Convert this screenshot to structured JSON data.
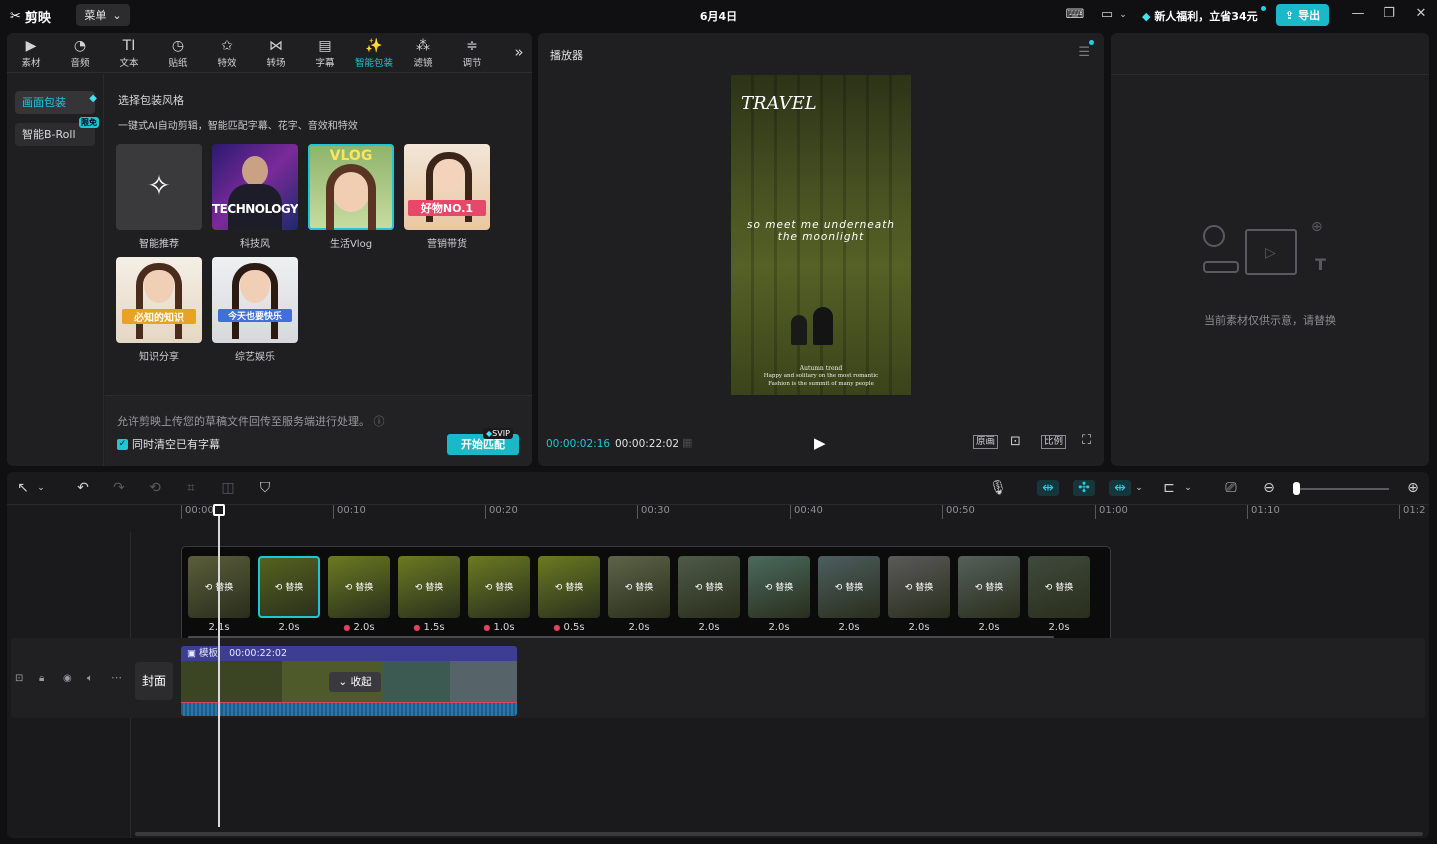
{
  "app": {
    "name": "剪映",
    "menu": "菜单",
    "date": "6月4日",
    "promo": "新人福利，立省34元",
    "export": "导出"
  },
  "toolbar_tabs": [
    {
      "label": "素材",
      "icon": "media-icon"
    },
    {
      "label": "音频",
      "icon": "audio-icon"
    },
    {
      "label": "文本",
      "icon": "text-icon"
    },
    {
      "label": "贴纸",
      "icon": "sticker-icon"
    },
    {
      "label": "特效",
      "icon": "effect-icon"
    },
    {
      "label": "转场",
      "icon": "transition-icon"
    },
    {
      "label": "字幕",
      "icon": "caption-icon"
    },
    {
      "label": "智能包装",
      "icon": "smart-pack-icon"
    },
    {
      "label": "滤镜",
      "icon": "filter-icon"
    },
    {
      "label": "调节",
      "icon": "adjust-icon"
    }
  ],
  "sidebar": {
    "item1": "画面包装",
    "item2": "智能B-Roll",
    "free_badge": "限免"
  },
  "panel": {
    "title": "选择包装风格",
    "subtitle": "一键式AI自动剪辑，智能匹配字幕、花字、音效和特效",
    "styles": [
      {
        "label": "智能推荐"
      },
      {
        "label": "科技风",
        "overlay": "TECHNOLOGY"
      },
      {
        "label": "生活Vlog",
        "overlay": "VLOG"
      },
      {
        "label": "营销带货",
        "overlay": "好物NO.1"
      },
      {
        "label": "知识分享",
        "overlay": "必知的知识"
      },
      {
        "label": "综艺娱乐",
        "overlay": "今天也要快乐"
      }
    ],
    "footer_note": "允许剪映上传您的草稿文件回传至服务端进行处理。",
    "checkbox_label": "同时清空已有字幕",
    "start_button": "开始匹配",
    "svip": "SVIP"
  },
  "player": {
    "title": "播放器",
    "video_title": "TRAVEL",
    "video_line1": "so meet me underneath",
    "video_line2": "the moonlight",
    "video_caption1": "Autumn trend",
    "video_caption2": "Happy and solitary on the most romantic",
    "video_caption3": "Fashion is the summit of many people",
    "current_time": "00:00:02:16",
    "total_time": "00:00:22:02",
    "btn_original": "原画",
    "btn_ratio": "比例"
  },
  "right_panel": {
    "note": "当前素材仅供示意，请替换"
  },
  "timeline": {
    "ruler": [
      "00:00",
      "00:10",
      "00:20",
      "00:30",
      "00:40",
      "00:50",
      "01:00",
      "01:10",
      "01:2"
    ],
    "replace": "替换",
    "clips": [
      {
        "duration": "2.1s",
        "dot": false,
        "selected": false,
        "color": "#5a5e3a"
      },
      {
        "duration": "2.0s",
        "dot": false,
        "selected": true,
        "color": "#56641f"
      },
      {
        "duration": "2.0s",
        "dot": true,
        "selected": false,
        "color": "#6b7a22"
      },
      {
        "duration": "1.5s",
        "dot": true,
        "selected": false,
        "color": "#6b7a22"
      },
      {
        "duration": "1.0s",
        "dot": true,
        "selected": false,
        "color": "#6b7a22"
      },
      {
        "duration": "0.5s",
        "dot": true,
        "selected": false,
        "color": "#6b7a22"
      },
      {
        "duration": "2.0s",
        "dot": false,
        "selected": false,
        "color": "#5e6448"
      },
      {
        "duration": "2.0s",
        "dot": false,
        "selected": false,
        "color": "#4e5a48"
      },
      {
        "duration": "2.0s",
        "dot": false,
        "selected": false,
        "color": "#4a6a5e"
      },
      {
        "duration": "2.0s",
        "dot": false,
        "selected": false,
        "color": "#4c5e60"
      },
      {
        "duration": "2.0s",
        "dot": false,
        "selected": false,
        "color": "#5a5a5a"
      },
      {
        "duration": "2.0s",
        "dot": false,
        "selected": false,
        "color": "#55605a"
      },
      {
        "duration": "2.0s",
        "dot": false,
        "selected": false,
        "color": "#3f4a3c"
      }
    ],
    "main_track_label": "模板",
    "main_track_time": "00:00:22:02",
    "collapse": "收起",
    "cover": "封面"
  }
}
